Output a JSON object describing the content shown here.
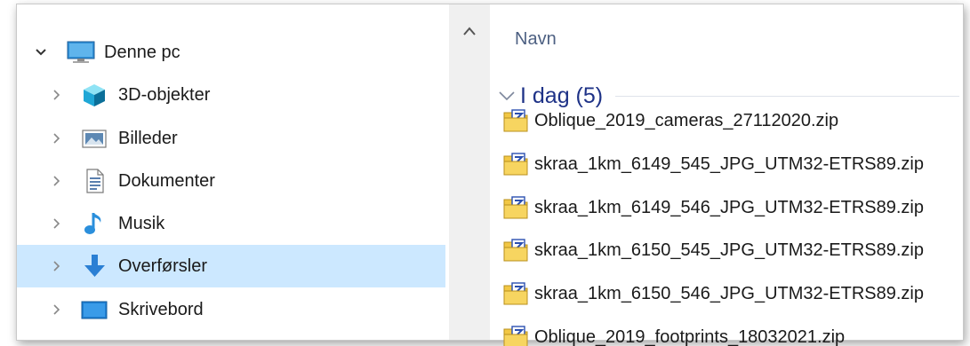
{
  "navigation": {
    "root": {
      "label": "Denne pc",
      "icon": "computer-icon",
      "expanded": true
    },
    "items": [
      {
        "label": "3D-objekter",
        "icon": "3d-objects-icon",
        "selected": false
      },
      {
        "label": "Billeder",
        "icon": "pictures-icon",
        "selected": false
      },
      {
        "label": "Dokumenter",
        "icon": "documents-icon",
        "selected": false
      },
      {
        "label": "Musik",
        "icon": "music-icon",
        "selected": false
      },
      {
        "label": "Overførsler",
        "icon": "downloads-icon",
        "selected": true
      },
      {
        "label": "Skrivebord",
        "icon": "desktop-icon",
        "selected": false
      }
    ]
  },
  "file_list": {
    "column_header": "Navn",
    "group": {
      "label": "I dag (5)",
      "expanded": true
    },
    "files": [
      {
        "name": "Oblique_2019_cameras_27112020.zip",
        "icon": "zip-folder-icon"
      },
      {
        "name": "skraa_1km_6149_545_JPG_UTM32-ETRS89.zip",
        "icon": "zip-folder-icon"
      },
      {
        "name": "skraa_1km_6149_546_JPG_UTM32-ETRS89.zip",
        "icon": "zip-folder-icon"
      },
      {
        "name": "skraa_1km_6150_545_JPG_UTM32-ETRS89.zip",
        "icon": "zip-folder-icon"
      },
      {
        "name": "skraa_1km_6150_546_JPG_UTM32-ETRS89.zip",
        "icon": "zip-folder-icon"
      },
      {
        "name": "Oblique_2019_footprints_18032021.zip",
        "icon": "zip-folder-icon"
      }
    ]
  },
  "colors": {
    "selected_background": "#cce8ff",
    "header_text": "#4d6082",
    "group_text": "#1e3287",
    "scrollbar": "#f0f0f0"
  }
}
